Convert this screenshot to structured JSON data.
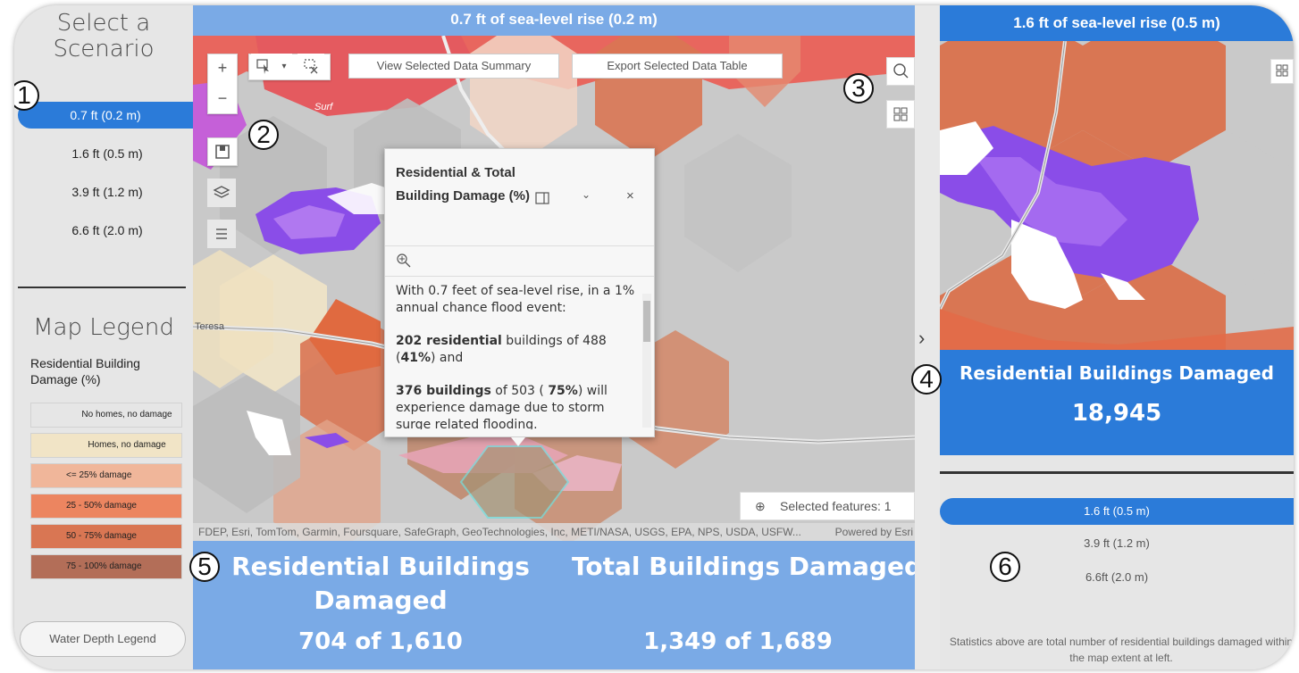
{
  "left_panel": {
    "title": "Select a Scenario",
    "scenarios": [
      "0.7 ft (0.2 m)",
      "1.6 ft (0.5 m)",
      "3.9 ft (1.2 m)",
      "6.6 ft (2.0 m)"
    ],
    "active_scenario": "0.7 ft (0.2 m)",
    "legend": {
      "title": "Map Legend",
      "subtitle": "Residential Building Damage (%)",
      "items": [
        {
          "label": "No homes, no damage",
          "color": "#e6e6e6"
        },
        {
          "label": "Homes, no damage",
          "color": "#f1e4c6"
        },
        {
          "label": "<= 25% damage",
          "color": "#f0b69a"
        },
        {
          "label": "25 - 50% damage",
          "color": "#ec8560"
        },
        {
          "label": "50 - 75% damage",
          "color": "#d97653"
        },
        {
          "label": "75 - 100% damage",
          "color": "#b36e58"
        }
      ]
    },
    "water_depth_button": "Water Depth Legend"
  },
  "map_main": {
    "header": "0.7 ft of sea-level rise (0.2 m)",
    "toolbar": {
      "zoom_in": "+",
      "zoom_out": "−",
      "view_summary_button": "View Selected Data Summary",
      "export_table_button": "Export Selected Data Table"
    },
    "map_labels": {
      "surf": "Surf",
      "teresa": "Teresa"
    },
    "popup": {
      "title": "Residential & Total Building Damage (%)",
      "body_line1": "With 0.7 feet of sea-level rise, in a 1% annual chance flood event:",
      "res_count": "202 residential",
      "res_mid": " buildings of 488 (",
      "res_pct": "41%",
      "res_end": ") and",
      "tot_count": "376 buildings",
      "tot_mid": " of 503 ( ",
      "tot_pct": "75%",
      "tot_end": ") will experience damage due to storm surge related flooding."
    },
    "selected_features": "Selected features: 1",
    "attribution": "FDEP, Esri, TomTom, Garmin, Foursquare, SafeGraph, GeoTechnologies, Inc, METI/NASA, USGS, EPA, NPS, USDA, USFW...",
    "powered_by": "Powered by Esri",
    "stats": {
      "residential_label": "Residential Buildings Damaged",
      "residential_value": "704 of 1,610",
      "total_label": "Total Buildings Damaged",
      "total_value": "1,349 of 1,689"
    }
  },
  "right_panel": {
    "header": "1.6 ft of sea-level rise (0.5 m)",
    "stat_label": "Residential Buildings Damaged",
    "stat_value": "18,945",
    "scenarios": [
      "1.6 ft (0.5 m)",
      "3.9 ft (1.2 m)",
      "6.6ft (2.0 m)"
    ],
    "active_scenario": "1.6 ft (0.5 m)",
    "note": "Statistics above are total number of residential buildings damaged within the map extent at left."
  },
  "callouts": [
    "1",
    "2",
    "3",
    "4",
    "5",
    "6"
  ],
  "colors": {
    "accent_blue": "#2b7bd9",
    "light_blue": "#7aaae6",
    "flood_purple": "#8a4de8",
    "damage_orange": "#d97653",
    "damage_red_map": "#ea6158"
  }
}
